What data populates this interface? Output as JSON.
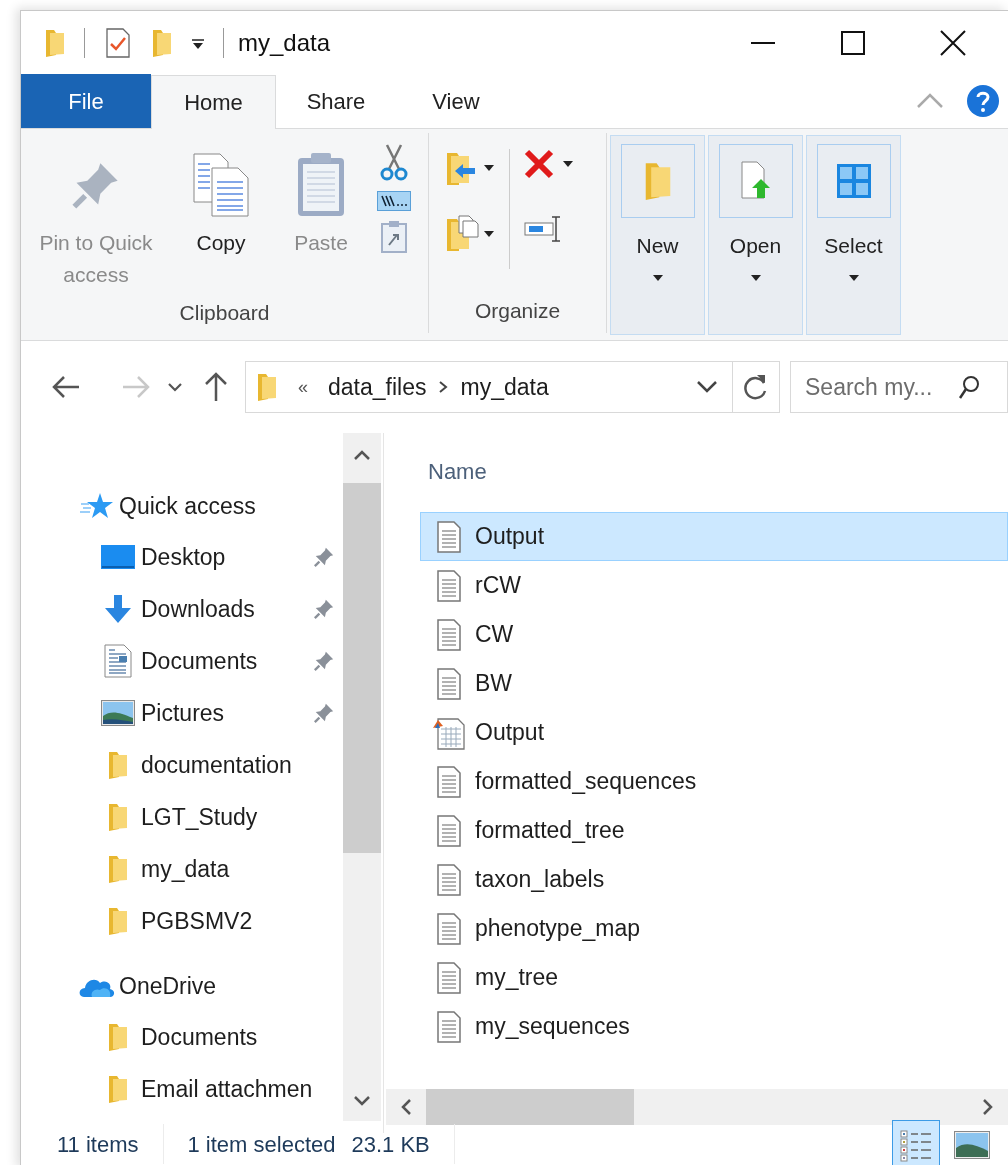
{
  "window": {
    "title": "my_data"
  },
  "ribbon_tabs": [
    {
      "label": "File",
      "kind": "file",
      "selected": false
    },
    {
      "label": "Home",
      "kind": "tab",
      "selected": true
    },
    {
      "label": "Share",
      "kind": "tab",
      "selected": false
    },
    {
      "label": "View",
      "kind": "tab",
      "selected": false
    }
  ],
  "clipboard_group": {
    "label": "Clipboard",
    "buttons": [
      {
        "label": "Pin to Quick access",
        "kind": "pin",
        "disabled": true
      },
      {
        "label": "Copy",
        "kind": "copy",
        "disabled": false
      },
      {
        "label": "Paste",
        "kind": "paste",
        "disabled": true
      }
    ]
  },
  "organize_group": {
    "label": "Organize"
  },
  "large_buttons": [
    {
      "label": "New",
      "kind": "new"
    },
    {
      "label": "Open",
      "kind": "open"
    },
    {
      "label": "Select",
      "kind": "select"
    }
  ],
  "navigation": {
    "forward_disabled": true,
    "path_overflow": "«",
    "path": [
      "data_files",
      "my_data"
    ],
    "search": {
      "placeholder": "Search my..."
    }
  },
  "sidebar": [
    {
      "label": "Quick access",
      "kind": "quick",
      "children": [
        {
          "label": "Desktop",
          "kind": "desktop",
          "pinned": true
        },
        {
          "label": "Downloads",
          "kind": "downloads",
          "pinned": true
        },
        {
          "label": "Documents",
          "kind": "documents",
          "pinned": true
        },
        {
          "label": "Pictures",
          "kind": "pictures",
          "pinned": true
        },
        {
          "label": "documentation",
          "kind": "folder",
          "pinned": false
        },
        {
          "label": "LGT_Study",
          "kind": "folder",
          "pinned": false
        },
        {
          "label": "my_data",
          "kind": "folder",
          "pinned": false
        },
        {
          "label": "PGBSMV2",
          "kind": "folder",
          "pinned": false
        }
      ]
    },
    {
      "label": "OneDrive",
      "kind": "cloud",
      "children": [
        {
          "label": "Documents",
          "kind": "folder",
          "pinned": false
        },
        {
          "label": "Email attachmen",
          "kind": "folder",
          "pinned": false
        }
      ]
    }
  ],
  "file_list": {
    "column": "Name",
    "files": [
      {
        "name": "Output",
        "kind": "text",
        "selected": true
      },
      {
        "name": "rCW",
        "kind": "text",
        "selected": false
      },
      {
        "name": "CW",
        "kind": "text",
        "selected": false
      },
      {
        "name": "BW",
        "kind": "text",
        "selected": false
      },
      {
        "name": "Output",
        "kind": "matlab",
        "selected": false
      },
      {
        "name": "formatted_sequences",
        "kind": "text",
        "selected": false
      },
      {
        "name": "formatted_tree",
        "kind": "text",
        "selected": false
      },
      {
        "name": "taxon_labels",
        "kind": "text",
        "selected": false
      },
      {
        "name": "phenotype_map",
        "kind": "text",
        "selected": false
      },
      {
        "name": "my_tree",
        "kind": "text",
        "selected": false
      },
      {
        "name": "my_sequences",
        "kind": "text",
        "selected": false
      }
    ]
  },
  "status_bar": {
    "item_count": "11 items",
    "selection": "1 item selected",
    "size": "23.1 KB",
    "views": [
      {
        "kind": "details",
        "selected": true
      },
      {
        "kind": "large_icons",
        "selected": false
      }
    ]
  }
}
